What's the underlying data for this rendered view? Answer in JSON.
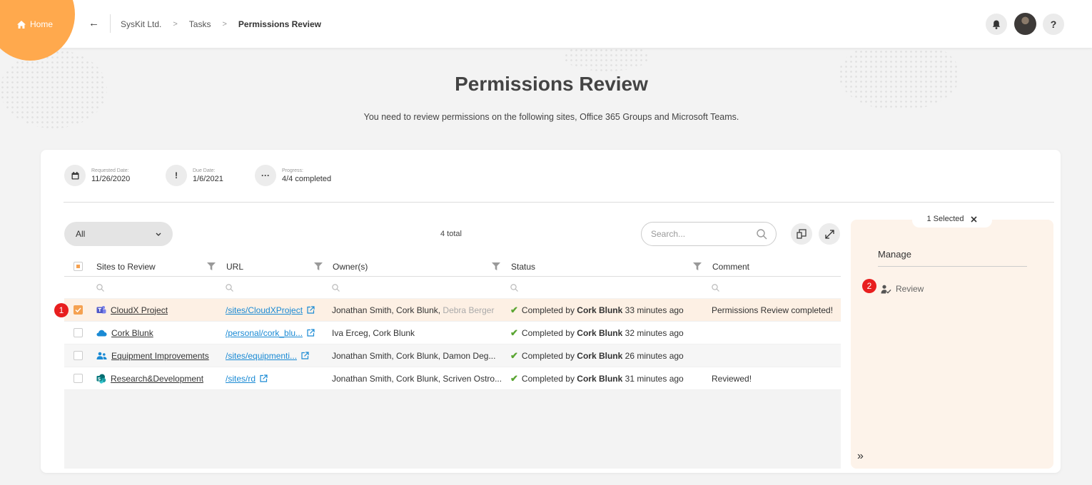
{
  "header": {
    "home_label": "Home",
    "breadcrumbs": [
      "SysKit Ltd.",
      "Tasks",
      "Permissions Review"
    ],
    "help_label": "?"
  },
  "page": {
    "title": "Permissions Review",
    "subtitle": "You need to review permissions on the following sites, Office 365 Groups and Microsoft Teams."
  },
  "meta": {
    "requested_label": "Requested Date:",
    "requested_value": "11/26/2020",
    "due_label": "Due Date:",
    "due_value": "1/6/2021",
    "progress_label": "Progress:",
    "progress_value": "4/4 completed"
  },
  "toolbar": {
    "filter_value": "All",
    "total": "4 total",
    "search_placeholder": "Search..."
  },
  "table": {
    "columns": [
      "Sites to Review",
      "URL",
      "Owner(s)",
      "Status",
      "Comment"
    ],
    "rows": [
      {
        "site": "CloudX Project",
        "site_icon": "teams-icon",
        "url": "/sites/CloudXProject",
        "owners": "Jonathan Smith, Cork Blunk,",
        "owners_muted": "Debra Berger",
        "status_prefix": "Completed by",
        "status_user": "Cork Blunk",
        "status_time": "33 minutes ago",
        "comment": "Permissions Review completed!",
        "selected": true
      },
      {
        "site": "Cork Blunk",
        "site_icon": "onedrive-icon",
        "url": "/personal/cork_blu...",
        "owners": "Iva Erceg, Cork Blunk",
        "owners_muted": "",
        "status_prefix": "Completed by",
        "status_user": "Cork Blunk",
        "status_time": "32 minutes ago",
        "comment": "",
        "selected": false
      },
      {
        "site": "Equipment Improvements",
        "site_icon": "group-icon",
        "url": "/sites/equipmenti...",
        "owners": "Jonathan Smith, Cork Blunk, Damon Deg...",
        "owners_muted": "",
        "status_prefix": "Completed by",
        "status_user": "Cork Blunk",
        "status_time": "26 minutes ago",
        "comment": "",
        "selected": false
      },
      {
        "site": "Research&Development",
        "site_icon": "sharepoint-icon",
        "url": "/sites/rd",
        "owners": "Jonathan Smith, Cork Blunk, Scriven Ostro...",
        "owners_muted": "",
        "status_prefix": "Completed by",
        "status_user": "Cork Blunk",
        "status_time": "31 minutes ago",
        "comment": "Reviewed!",
        "selected": false
      }
    ]
  },
  "side_panel": {
    "selected_label": "1 Selected",
    "manage_label": "Manage",
    "review_label": "Review"
  },
  "badges": [
    "1",
    "2"
  ],
  "colors": {
    "accent": "#ffa94d",
    "link": "#1a8ad4",
    "badge": "#e81e1e",
    "check": "#5aa532",
    "selected_row": "#fdf0e4"
  }
}
